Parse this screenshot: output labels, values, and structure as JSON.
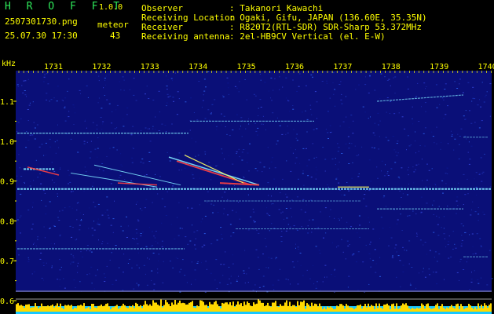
{
  "header": {
    "app_name": "H R O F F T",
    "version": "1.0.0",
    "filename": "2507301730.png",
    "datetime": "25.07.30 17:30",
    "meteor_label": "meteor",
    "meteor_count": "43",
    "fields": [
      {
        "label": "Observer",
        "value": ": Takanori Kawachi"
      },
      {
        "label": "Receiving Location",
        "value": ": Ogaki, Gifu, JAPAN (136.60E, 35.35N)"
      },
      {
        "label": "Receiver",
        "value": ": R820T2(RTL-SDR) SDR-Sharp 53.372MHz"
      },
      {
        "label": "Receiving antenna",
        "value": ": 2el-HB9CV Vertical (el. E-W)"
      }
    ]
  },
  "chart_data": {
    "type": "heatmap",
    "ylabel": "kHz",
    "y_ticks": [
      "1.1",
      "1.0",
      "0.9",
      "0.8",
      "0.7",
      "0.6"
    ],
    "x_ticks": [
      "1731",
      "1732",
      "1733",
      "1734",
      "1735",
      "1736",
      "1737",
      "1738",
      "1739",
      "1740"
    ],
    "colors": {
      "background": "#0a0f78",
      "axis_text": "#ffff00",
      "signal": "#7ee6ff",
      "strong_signal": "#ff4040",
      "histogram": "#ffd800",
      "histogram_base": "#18c8ff"
    }
  }
}
